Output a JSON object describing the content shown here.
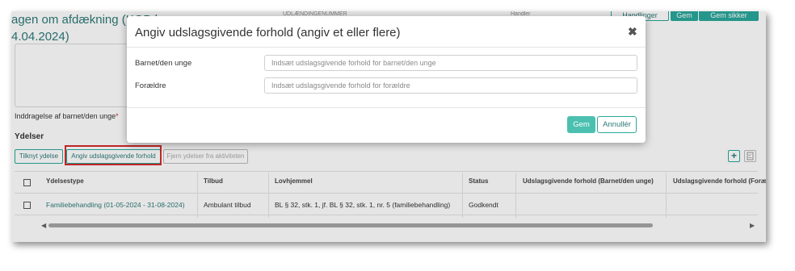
{
  "page": {
    "case_title_line1": "agen om afdækning (KGB l",
    "case_title_line2": "4.04.2024)",
    "header_field_label": "UDLÆNDINGENUMMER",
    "header_small_label": "Handler",
    "top_buttons": [
      "Handlinger",
      "Gem",
      "Gem sikker"
    ]
  },
  "form": {
    "inddragelse_label": "Inddragelse af barnet/den unge",
    "required_mark": "*",
    "section_title": "Ydelser"
  },
  "toolbar": {
    "tilknyt_label": "Tilknyt ydelse",
    "angiv_label": "Angiv udslagsgivende forhold",
    "fjern_label": "Fjern ydelser fra aktiviteten",
    "add_icon": "plus-icon",
    "checklist_icon": "checklist-icon"
  },
  "table": {
    "headers": [
      "Ydelsestype",
      "Tilbud",
      "Lovhjemmel",
      "Status",
      "Udslagsgivende forhold (Barnet/den unge)",
      "Udslagsgivende forhold (Foræ"
    ],
    "rows": [
      {
        "ydelsestype": "Familiebehandling (01-05-2024 - 31-08-2024)",
        "tilbud": "Ambulant tilbud",
        "lovhjemmel": "BL § 32, stk. 1, jf. BL § 32, stk. 1, nr. 5 (familiebehandling)",
        "status": "Godkendt"
      }
    ]
  },
  "modal": {
    "title": "Angiv udslagsgivende forhold (angiv et eller flere)",
    "close_symbol": "✖",
    "fields": [
      {
        "label": "Barnet/den unge",
        "placeholder": "Indsæt udslagsgivende forhold for barnet/den unge",
        "value": ""
      },
      {
        "label": "Forældre",
        "placeholder": "Indsæt udslagsgivende forhold for forældre",
        "value": ""
      }
    ],
    "save_label": "Gem",
    "cancel_label": "Annullér"
  },
  "colors": {
    "accent": "#2aa79b",
    "accent_text": "#2d7a78",
    "primary_button": "#4bc0b0",
    "highlight_box": "#d62b2b"
  }
}
